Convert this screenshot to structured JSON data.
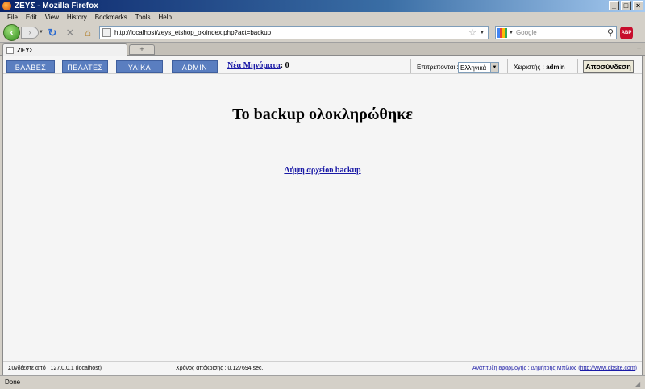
{
  "window": {
    "title": "ΖΕΥΣ - Mozilla Firefox",
    "buttons": {
      "minimize": "_",
      "maximize": "□",
      "close": "×"
    }
  },
  "menu": [
    "File",
    "Edit",
    "View",
    "History",
    "Bookmarks",
    "Tools",
    "Help"
  ],
  "toolbar": {
    "url": "http://localhost/zeys_etshop_ok/index.php?act=backup",
    "search_placeholder": "Google",
    "abp_label": "ABP"
  },
  "tabs": {
    "active_label": "ΖΕΥΣ",
    "new_tab": "+",
    "list": "–"
  },
  "nav": {
    "buttons": [
      "ΒΛΑΒΕΣ",
      "ΠΕΛΑΤΕΣ",
      "ΥΛΙΚΑ",
      "ADMIN"
    ],
    "messages_label": "Νέα Μηνύματα",
    "messages_count": "0",
    "language_label": "Επιτρέπονται :",
    "language_value": "Ελληνικά",
    "user_label": "Χειριστής :",
    "user_name": "admin",
    "logout": "Αποσύνδεση"
  },
  "main": {
    "title": "Το backup ολοκληρώθηκε",
    "download_link": "Λήψη αρχείου backup"
  },
  "footer": {
    "connection": "Συνδέεστε από : 127.0.0.1 (localhost)",
    "response_time": "Χρόνος απόκρισης : 0.127694 sec.",
    "credits": "Ανάπτυξη εφαρμογής : Δημήτρης Μπίλιος",
    "credits_link": "http://www.dbsite.com"
  },
  "status": {
    "text": "Done"
  },
  "colors": {
    "nav_button": "#5a7ec0",
    "link": "#1a1aa6",
    "titlebar": "#0a246a"
  }
}
